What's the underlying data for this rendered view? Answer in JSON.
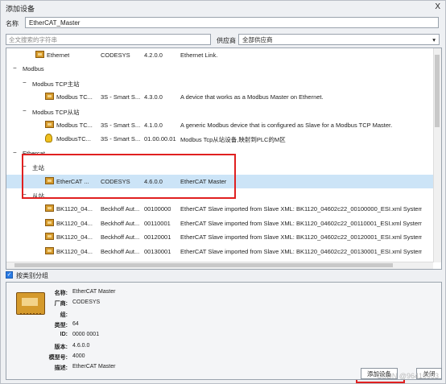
{
  "window": {
    "title": "添加设备",
    "close_glyph": "X"
  },
  "name_field": {
    "label": "名称",
    "value": "EtherCAT_Master"
  },
  "search": {
    "placeholder": "全文搜索的字符串"
  },
  "vendor": {
    "label": "供应商",
    "value": "全部供应商"
  },
  "tree_rows": [
    {
      "kind": "device",
      "indent": 2,
      "name": "Ethernet",
      "vendor": "CODESYS",
      "version": "4.2.0.0",
      "description": "Ethernet Link."
    },
    {
      "kind": "group",
      "indent": 1,
      "toggle": "−",
      "name": "Modbus"
    },
    {
      "kind": "group",
      "indent": 2,
      "toggle": "−",
      "name": "Modbus TCP主站"
    },
    {
      "kind": "device",
      "indent": 3,
      "name": "Modbus TC...",
      "vendor": "3S - Smart S...",
      "version": "4.3.0.0",
      "description": "A device that works as a Modbus Master on Ethernet."
    },
    {
      "kind": "group",
      "indent": 2,
      "toggle": "−",
      "name": "Modbus TCP从站"
    },
    {
      "kind": "device",
      "indent": 3,
      "name": "Modbus TC...",
      "vendor": "3S - Smart S...",
      "version": "4.1.0.0",
      "description": "A generic Modbus device that is configured as Slave for a Modbus TCP Master."
    },
    {
      "kind": "device",
      "indent": 3,
      "icon": "bulb",
      "name": "ModbusTC...",
      "vendor": "3S - Smart S...",
      "version": "01.00.00.01",
      "description": "Modbus Tcp从站设备,映射到PLC的M区"
    },
    {
      "kind": "group",
      "indent": 1,
      "toggle": "−",
      "name": "Ethercat"
    },
    {
      "kind": "group",
      "indent": 2,
      "toggle": "−",
      "name": "主站"
    },
    {
      "kind": "device",
      "indent": 3,
      "selected": true,
      "name": "EtherCAT ...",
      "vendor": "CODESYS",
      "version": "4.6.0.0",
      "description": "EtherCAT Master"
    },
    {
      "kind": "group",
      "indent": 2,
      "toggle": "−",
      "name": "从站"
    },
    {
      "kind": "device",
      "indent": 3,
      "name": "BK1120_04...",
      "vendor": "Beckhoff Aut...",
      "version": "00100000",
      "description": "EtherCAT Slave imported from Slave XML: BK1120_04602c22_00100000_ESI.xml System Ter..."
    },
    {
      "kind": "device",
      "indent": 3,
      "name": "BK1120_04...",
      "vendor": "Beckhoff Aut...",
      "version": "00110001",
      "description": "EtherCAT Slave imported from Slave XML: BK1120_04602c22_00110001_ESI.xml System Ter..."
    },
    {
      "kind": "device",
      "indent": 3,
      "name": "BK1120_04...",
      "vendor": "Beckhoff Aut...",
      "version": "00120001",
      "description": "EtherCAT Slave imported from Slave XML: BK1120_04602c22_00120001_ESI.xml System Ter..."
    },
    {
      "kind": "device",
      "indent": 3,
      "name": "BK1120_04...",
      "vendor": "Beckhoff Aut...",
      "version": "00130001",
      "description": "EtherCAT Slave imported from Slave XML: BK1120_04602c22_00130001_ESI.xml System Ter..."
    }
  ],
  "group_by_category": {
    "label": "按类别分组",
    "checked": true
  },
  "info": [
    {
      "key": "名称:",
      "value": "EtherCAT Master"
    },
    {
      "key": "厂商:",
      "value": "CODESYS"
    },
    {
      "key": "组:",
      "value": ""
    },
    {
      "key": "类型:",
      "value": "64"
    },
    {
      "key": "ID:",
      "value": "0000 0001"
    },
    {
      "key": "版本:",
      "value": "4.6.0.0"
    },
    {
      "key": "模型号:",
      "value": "4000"
    },
    {
      "key": "描述:",
      "value": "EtherCAT Master"
    }
  ],
  "buttons": {
    "add": "添加设备",
    "close": "关闭"
  },
  "watermark": "CSDN @96410903",
  "colors": {
    "selection": "#cce4f7",
    "highlight": "#e02020",
    "device_icon": "#d59a2c"
  }
}
